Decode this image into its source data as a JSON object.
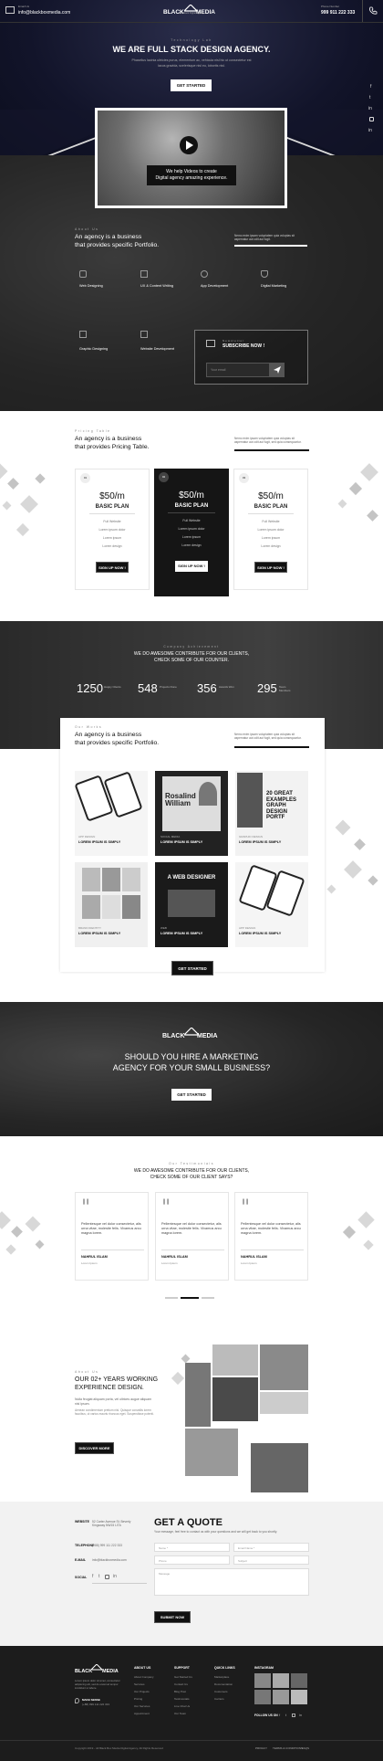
{
  "topbar": {
    "mail_label": "Email Us",
    "email": "info@blackboxmedia.com",
    "phone_label": "Phone Number",
    "phone": "999 911 222 333"
  },
  "logo": {
    "text_left": "BLACK",
    "text_right": "MEDIA",
    "tagline": "Full Stack Digital Agency"
  },
  "hero": {
    "eyebrow": "Technology Lab",
    "title": "WE ARE FULL STACK DESIGN AGENCY.",
    "subtitle_1": "Phasellus lacinia ultricies purus, elementum ac, vehicula nisl hic ut consectetur est",
    "subtitle_2": "lacus gravida, scelerisque nisl eu, lobortis nisl.",
    "cta": "GET STARTED"
  },
  "social": {
    "items": [
      "f",
      "t",
      "in",
      "ig",
      "in2"
    ]
  },
  "video": {
    "caption_1": "We help Videos to create",
    "caption_2": "Digital agency amazing experience."
  },
  "about": {
    "eyebrow": "About Us",
    "title_1": "An agency is a business",
    "title_2": "that provides specific Portfolio.",
    "desc": "Nemo enim ipsam voluptatem quia voluptas sit aspernatur aut odit aut fugit.",
    "services": [
      "Web Designing",
      "UX & Content Writing",
      "App Development",
      "Digital Marketing",
      "Graphic Designing",
      "Website Development"
    ],
    "newsletter_eyebrow": "Newsletter",
    "newsletter_title": "SUBSCRIBE NOW !",
    "newsletter_placeholder": "Your email"
  },
  "pricing": {
    "eyebrow": "Pricing Table",
    "title_1": "An agency is a business",
    "title_2": "that provides Pricing Table.",
    "desc": "Nemo enim ipsam voluptatem quia voluptas sit aspernatur aut odit aut fugit, sed quia consequuntur.",
    "plans": [
      {
        "badge": "01",
        "price": "$50/m",
        "name": "BASIC PLAN",
        "features": [
          "Full Website",
          "Lorem ipsum dolor",
          "Lorem ipsum",
          "Lorem design"
        ],
        "cta": "SIGN UP NOW !"
      },
      {
        "badge": "02",
        "price": "$50/m",
        "name": "BASIC PLAN",
        "features": [
          "Full Website",
          "Lorem ipsum dolor",
          "Lorem ipsum",
          "Lorem design"
        ],
        "cta": "SIGN UP NOW !"
      },
      {
        "badge": "03",
        "price": "$50/m",
        "name": "BASIC PLAN",
        "features": [
          "Full Website",
          "Lorem ipsum dolor",
          "Lorem ipsum",
          "Lorem design"
        ],
        "cta": "SIGN UP NOW !"
      }
    ]
  },
  "stats": {
    "eyebrow": "Company Achievement",
    "title_1": "WE DO AWESOME CONTRIBUTE FOR OUR CLIENTS,",
    "title_2": "CHECK SOME OF OUR COUNTER.",
    "items": [
      {
        "value": "1250",
        "label": "Happy Clients"
      },
      {
        "value": "548",
        "label": "Projects Done"
      },
      {
        "value": "356",
        "label": "Awards Won"
      },
      {
        "value": "295",
        "label": "Team Members"
      }
    ]
  },
  "works": {
    "eyebrow": "Our Works",
    "title_1": "An agency is a business",
    "title_2": "that provides specific Portfolio.",
    "desc": "Nemo enim ipsam voluptatem quia voluptas sit aspernatur aut odit aut fugit, sed quia consequuntur.",
    "items": [
      {
        "category": "APP DESIGN",
        "title": "LOREM IPSUM IS SIMPLY"
      },
      {
        "category": "SOCIAL MEDIA",
        "title": "LOREM IPSUM IS SIMPLY"
      },
      {
        "category": "GRAPHIC DESIGN",
        "title": "LOREM IPSUM IS SIMPLY"
      },
      {
        "category": "BRAND IDENTITY",
        "title": "LOREM IPSUM IS SIMPLY"
      },
      {
        "category": "WEB",
        "title": "LOREM IPSUM IS SIMPLY"
      },
      {
        "category": "APP DESIGN",
        "title": "LOREM IPSUM IS SIMPLY"
      }
    ],
    "card_text": {
      "rosalind": "Rosalind William",
      "great_1": "20 GREAT",
      "great_2": "EXAMPLES",
      "great_3": "GRAPH",
      "great_4": "DESIGN",
      "great_5": "PORTF",
      "designer": "A WEB DESIGNER"
    },
    "cta": "GET STARTED"
  },
  "cta_banner": {
    "logo_left": "BLACK",
    "logo_right": "MEDIA",
    "title_1": "SHOULD YOU HIRE A MARKETING",
    "title_2": "AGENCY FOR YOUR SMALL BUSINESS?",
    "cta": "GET STARTED"
  },
  "testimonials": {
    "eyebrow": "Our Testimonials",
    "title_1": "WE DO AWESOME CONTRIBUTE FOR OUR CLIENTS,",
    "title_2": "CHECK SOME OF OUR CLIENT SAYS?",
    "items": [
      {
        "quote": "Pellentesque vel dolor consectetur, alis urna vitae, molestie felis. Vivamus arcu magna lorem.",
        "name": "NAHRUL ISLAM",
        "role": "Lorem Ipsum"
      },
      {
        "quote": "Pellentesque vel dolor consectetur, alis urna vitae, molestie felis. Vivamus arcu magna lorem.",
        "name": "NAHRUL ISLAM",
        "role": "Lorem Ipsum"
      },
      {
        "quote": "Pellentesque vel dolor consectetur, alis urna vitae, molestie felis. Vivamus arcu magna lorem.",
        "name": "NAHRUL ISLAM",
        "role": "Lorem Ipsum"
      }
    ]
  },
  "experience": {
    "eyebrow": "About Us",
    "title_1": "OUR 02+ YEARS WORKING",
    "title_2": "EXPERIENCE DESIGN.",
    "desc_1": "Nulla feugiat aliquam porta, vel ultrices augue aliquam nisl ipsum.",
    "desc_2": "Aenean condimentum pretium nisl. Quisque convallis lorem faucibus, ut varius mauris rhoncus eget. Suspendisse potenti.",
    "cta": "DISCOVER MORE"
  },
  "contact": {
    "rows": [
      {
        "label": "WEBSITE",
        "value": "52 Carter Avenue St. Beverly Kingsway NW15 LITA"
      },
      {
        "label": "TELEPHONE",
        "value": "(+88) 999 111 222 333"
      },
      {
        "label": "E-MAIL",
        "value": "info@blackboxmedia.com"
      },
      {
        "label": "SOCIAL",
        "value": ""
      }
    ],
    "quote_title": "GET A QUOTE",
    "quote_desc": "Your message, feel free to contact us with your questions and we will get back to you shortly.",
    "fields": [
      "Name *",
      "Email Name *",
      "Phone",
      "Subject",
      "Message"
    ],
    "submit": "SUBMIT NOW"
  },
  "footer": {
    "logo_left": "BLACK",
    "logo_right": "MEDIA",
    "about": "Lorem ipsum dolor sit amet, consectetur adipiscing elit, sed do eiusmod tempor incididunt ut labore.",
    "address_label": "MAKE SENSE",
    "address": "(+88) 999 111 222 333",
    "cols": [
      {
        "title": "ABOUT US",
        "links": [
          "About Company",
          "Services",
          "Our Projects",
          "Pricing",
          "Our Services",
          "Appointment"
        ]
      },
      {
        "title": "SUPPORT",
        "links": [
          "Get Started Us",
          "Contact Us",
          "Blog Post",
          "Testimonials",
          "Live Chat Us",
          "Our Team"
        ]
      },
      {
        "title": "QUICK LINKS",
        "links": [
          "Marketplace",
          "Documentation",
          "Customers",
          "Carriers"
        ]
      },
      {
        "title": "INSTAGRAM",
        "links": []
      }
    ],
    "follow_label": "FOLLOW US ON",
    "copyright": "Copyright 2019 - All Black Box Media Digital Agency, All Rights Reserved",
    "bottom_links": [
      "PRIVACY",
      "TERMS & CONDITIONS",
      "FAQS"
    ]
  }
}
